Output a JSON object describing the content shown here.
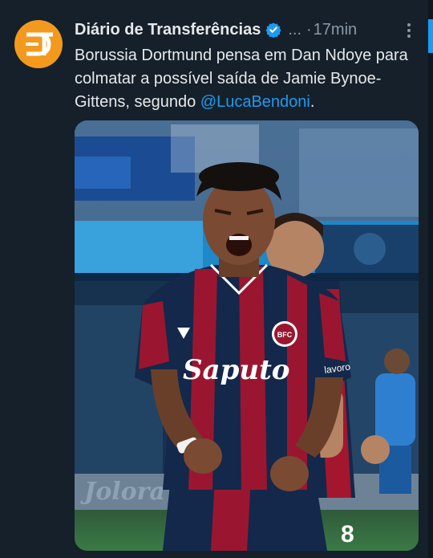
{
  "tweet": {
    "author_name": "Diário de Transferências",
    "handle": "...",
    "separator": "·",
    "time": "17min",
    "avatar_text": "DT",
    "text_before": "Borussia Dortmund pensa em Dan Ndoye para colmatar a possível saída de Jamie Bynoe-Gittens, segundo ",
    "mention": "@LucaBendoni",
    "text_after": "."
  },
  "photo": {
    "sponsor": "Saputo",
    "sleeve_brand": "lavoro",
    "crest": "BFC",
    "number": "8",
    "background_board_text": "Jolora"
  },
  "colors": {
    "background": "#15202b",
    "text": "#e7e9ea",
    "secondary": "#8b98a5",
    "accent": "#1d9bf0",
    "avatar": "#f39a1e"
  }
}
